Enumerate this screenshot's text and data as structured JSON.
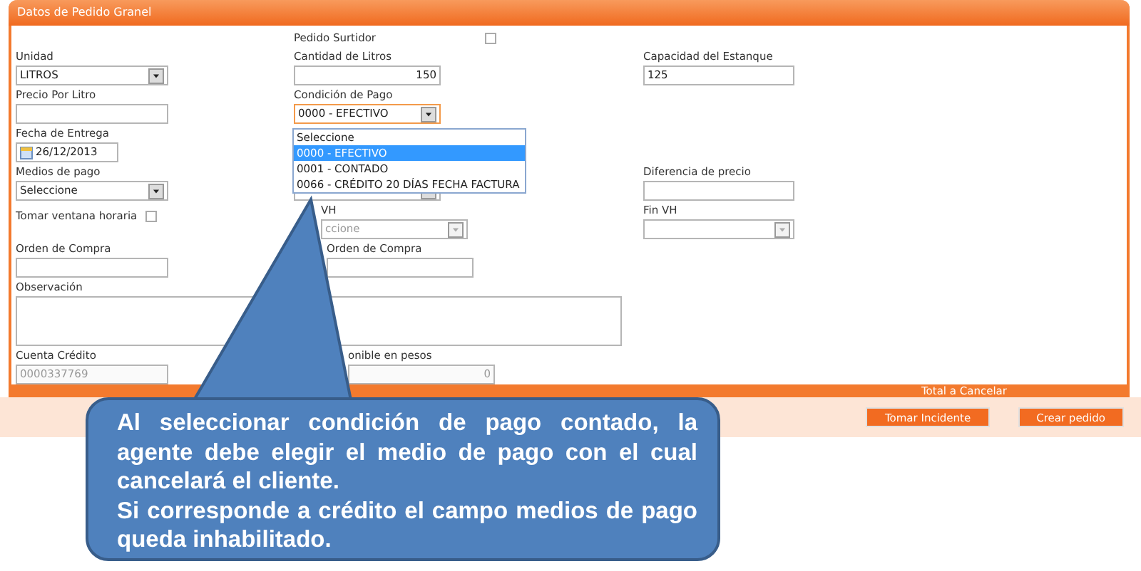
{
  "panel": {
    "title": "Datos de Pedido Granel"
  },
  "rows": [
    {
      "middle": {
        "kind": "checkbox",
        "label": "Pedido Surtidor",
        "checked": false
      }
    },
    {
      "left": {
        "kind": "select",
        "label": "Unidad",
        "value": "LITROS"
      },
      "middle": {
        "kind": "text",
        "label": "Cantidad de Litros",
        "value": "150",
        "right_aligned": true
      },
      "right": {
        "kind": "text",
        "label": "Capacidad del Estanque",
        "value": "125"
      }
    },
    {
      "left": {
        "kind": "text",
        "label": "Precio Por Litro"
      },
      "middle": {
        "kind": "select",
        "label": "Condición de Pago",
        "value": "0000 - EFECTIVO",
        "focused": true
      }
    },
    {
      "left": {
        "kind": "date",
        "label": "Fecha de Entrega",
        "value": "26/12/2013"
      }
    },
    {
      "left": {
        "kind": "select",
        "label": "Medios de pago",
        "value": "Seleccione"
      },
      "middle": {
        "kind": "select"
      },
      "right": {
        "kind": "text",
        "label": "Diferencia de precio"
      }
    },
    {
      "left": {
        "kind": "checkbox",
        "label": "Tomar ventana horaria",
        "checked": false
      },
      "middle": {
        "kind": "select",
        "label": "VH",
        "value": "ccione",
        "disabled": true
      },
      "right": {
        "kind": "select",
        "label": "Fin VH",
        "disabled": true
      }
    },
    {
      "left": {
        "kind": "text",
        "label": "Orden de Compra"
      },
      "middle": {
        "kind": "text",
        "label": "Orden de Compra"
      }
    },
    {
      "left": {
        "kind": "textarea",
        "label": "Observación"
      }
    },
    {
      "left": {
        "kind": "text",
        "label": "Cuenta Crédito",
        "value": "0000337769",
        "disabled": true
      },
      "middle": {
        "kind": "text",
        "label": "onible en pesos",
        "value": "0",
        "right_aligned": true,
        "disabled": true
      }
    }
  ],
  "condition_dropdown": {
    "options": [
      {
        "label": "Seleccione",
        "selected": false
      },
      {
        "label": "0000 - EFECTIVO",
        "selected": true
      },
      {
        "label": "0001 - CONTADO",
        "selected": false
      },
      {
        "label": "0066 - CRÉDITO 20 DÍAS FECHA FACTURA",
        "selected": false
      }
    ]
  },
  "total_label": "Total a Cancelar",
  "buttons": [
    "Tomar Incidente",
    "Crear pedido"
  ],
  "callout": {
    "paragraphs": [
      "Al seleccionar condición de pago contado, la agente debe elegir el medio de pago con el cual cancelará el cliente.",
      "Si corresponde a  crédito el campo medios de pago queda inhabilitado."
    ]
  }
}
